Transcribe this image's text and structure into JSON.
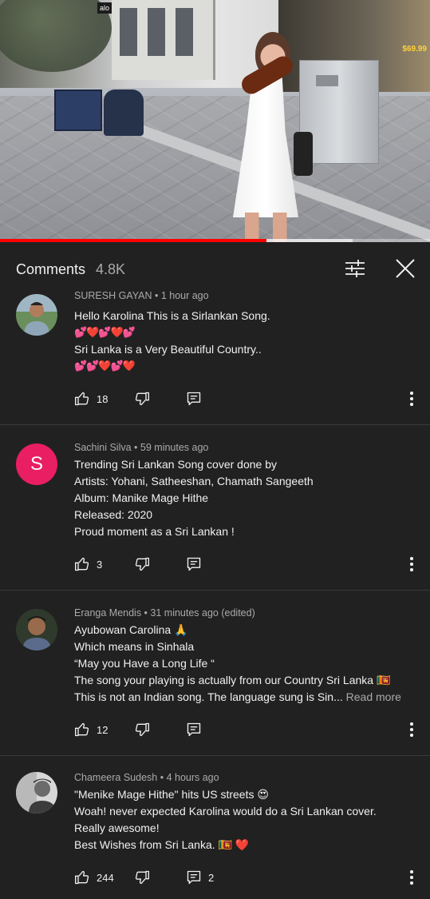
{
  "video": {
    "store_sign": "alo",
    "price_tag": "$69.99",
    "progress_fraction": 0.62,
    "buffer_fraction": 0.82,
    "accent_color": "#ff0000"
  },
  "header": {
    "title": "Comments",
    "count": "4.8K",
    "filter_icon": "sort-filter-icon",
    "close_icon": "close-icon"
  },
  "comments": [
    {
      "author": "SURESH GAYAN",
      "time": "1 hour ago",
      "lines": [
        "Hello Karolina This is a Sirlankan Song.",
        "💕❤️💕❤️💕",
        "Sri Lanka is a Very Beautiful Country..",
        "💕💕❤️💕❤️"
      ],
      "likes": "18",
      "replies": ""
    },
    {
      "author": "Sachini Silva",
      "avatar_letter": "S",
      "avatar_color": "#e91e63",
      "time": "59 minutes ago",
      "lines": [
        "Trending Sri Lankan Song cover done by",
        "Artists: Yohani, Satheeshan, Chamath Sangeeth",
        "Album: Manike Mage Hithe",
        "Released: 2020",
        "Proud moment as a Sri Lankan !"
      ],
      "likes": "3",
      "replies": ""
    },
    {
      "author": "Eranga Mendis",
      "time": "31 minutes ago (edited)",
      "lines": [
        "Ayubowan Carolina 🙏",
        "Which means in Sinhala",
        "“May you Have a Long Life “",
        "The song your playing is actually from our Country Sri Lanka 🇱🇰",
        "This is not an Indian song. The language sung is Sin..."
      ],
      "read_more": "Read more",
      "likes": "12",
      "replies": ""
    },
    {
      "author": "Chameera Sudesh",
      "time": "4 hours ago",
      "lines": [
        "\"Menike Mage Hithe\" hits US streets 😍",
        "Woah! never expected Karolina would do a Sri Lankan cover.",
        "Really awesome!",
        "Best Wishes from Sri Lanka. 🇱🇰 ❤️"
      ],
      "likes": "244",
      "replies": "2"
    }
  ],
  "icons": {
    "like": "thumb-up-icon",
    "dislike": "thumb-down-icon",
    "reply": "reply-comment-icon",
    "more": "more-vertical-icon"
  }
}
